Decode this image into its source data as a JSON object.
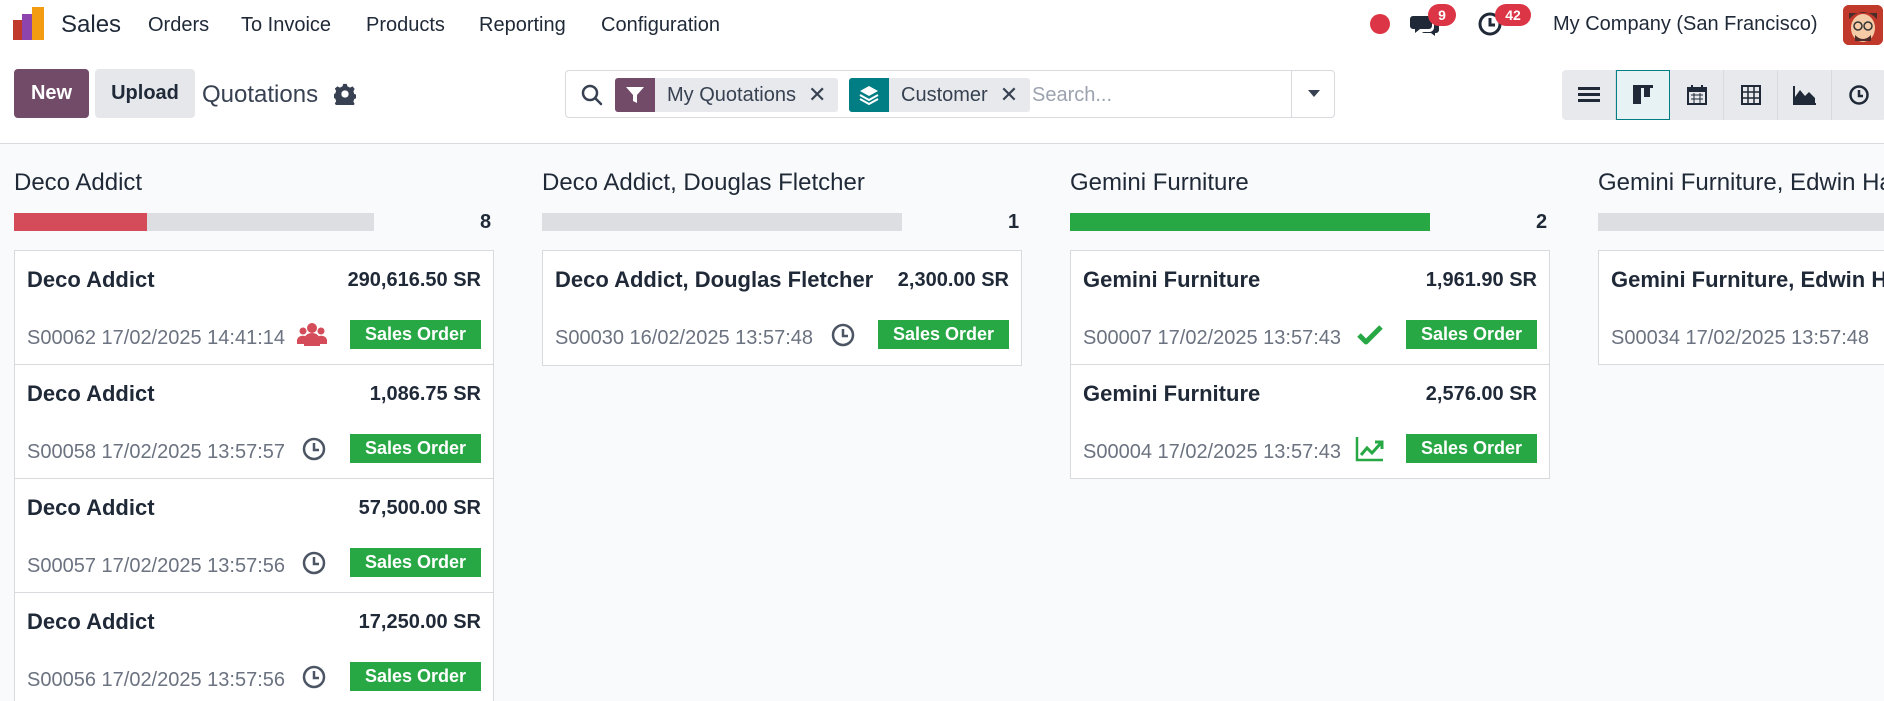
{
  "app": {
    "name": "Sales"
  },
  "menu": [
    "Orders",
    "To Invoice",
    "Products",
    "Reporting",
    "Configuration"
  ],
  "systray": {
    "messages_count": "9",
    "activities_count": "42",
    "company": "My Company (San Francisco)"
  },
  "control": {
    "new_label": "New",
    "upload_label": "Upload",
    "breadcrumb": "Quotations",
    "search": {
      "facets": [
        {
          "label": "My Quotations",
          "icon": "filter-icon",
          "color": "#714b67"
        },
        {
          "label": "Customer",
          "icon": "layers-icon",
          "color": "#017e84"
        }
      ],
      "placeholder": "Search..."
    },
    "views": [
      "list",
      "kanban",
      "calendar",
      "pivot",
      "graph",
      "activity"
    ],
    "active_view": "kanban"
  },
  "columns": [
    {
      "title": "Deco Addict",
      "count": "8",
      "progress_fraction": 0.37,
      "progress_color": "#d44c59",
      "cards": [
        {
          "customer": "Deco Addict",
          "amount": "290,616.50 SR",
          "meta": "S00062 17/02/2025 14:41:14",
          "activity": "users-icon",
          "status": "Sales Order"
        },
        {
          "customer": "Deco Addict",
          "amount": "1,086.75 SR",
          "meta": "S00058 17/02/2025 13:57:57",
          "activity": "clock-icon",
          "status": "Sales Order"
        },
        {
          "customer": "Deco Addict",
          "amount": "57,500.00 SR",
          "meta": "S00057 17/02/2025 13:57:56",
          "activity": "clock-icon",
          "status": "Sales Order"
        },
        {
          "customer": "Deco Addict",
          "amount": "17,250.00 SR",
          "meta": "S00056 17/02/2025 13:57:56",
          "activity": "clock-icon",
          "status": "Sales Order"
        }
      ]
    },
    {
      "title": "Deco Addict, Douglas Fletcher",
      "count": "1",
      "progress_fraction": 0,
      "progress_color": "#dcdee2",
      "cards": [
        {
          "customer": "Deco Addict, Douglas Fletcher",
          "amount": "2,300.00 SR",
          "meta": "S00030 16/02/2025 13:57:48",
          "activity": "clock-icon",
          "status": "Sales Order"
        }
      ]
    },
    {
      "title": "Gemini Furniture",
      "count": "2",
      "progress_fraction": 1,
      "progress_color": "#28a745",
      "cards": [
        {
          "customer": "Gemini Furniture",
          "amount": "1,961.90 SR",
          "meta": "S00007 17/02/2025 13:57:43",
          "activity": "check-icon",
          "status": "Sales Order"
        },
        {
          "customer": "Gemini Furniture",
          "amount": "2,576.00 SR",
          "meta": "S00004 17/02/2025 13:57:43",
          "activity": "trend-up-icon",
          "status": "Sales Order"
        }
      ]
    },
    {
      "title": "Gemini Furniture, Edwin Hansen",
      "count": "",
      "progress_fraction": 0,
      "progress_color": "#dcdee2",
      "cards": [
        {
          "customer": "Gemini Furniture, Edwin Hansen",
          "amount": "",
          "meta": "S00034 17/02/2025 13:57:48",
          "activity": "",
          "status": ""
        }
      ]
    }
  ]
}
